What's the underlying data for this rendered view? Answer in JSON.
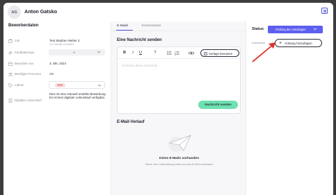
{
  "candidate": {
    "initials": "AG",
    "name": "Anton Gatsko"
  },
  "left": {
    "title": "Bewerberdaten",
    "job_label": "Job",
    "job_value": "Test Stephen Weber 3",
    "job_sub": "Von Kandelo Immobilia",
    "type_label": "Kandidatentyp",
    "type_value": "A",
    "applied_label": "Beworben am",
    "applied_value": "3. Okt. 2024",
    "involved_label": "Beteiligte Personen",
    "involved_value": "AG",
    "labels_label": "Labels",
    "labels_tag": "TEST",
    "cv_label": "Digitaler Lebenslauf",
    "cv_value": "Dies ist eine manuell erstellte Bewerbung. Es ist kein digitaler Lebenslauf verfügbar."
  },
  "mid": {
    "tab_emails": "E-Mails",
    "tab_comments": "Kommentare",
    "new_message_title": "Eine Nachricht senden",
    "template_button": "Vorlage benutzen",
    "placeholder": "Schreibe deine Nachricht",
    "send_button": "Nachricht senden",
    "history_title": "E-Mail-Verlauf",
    "empty_title": "Keine E-Mails vorhanden",
    "empty_sub": "Starte eine Unterhaltung indem du eine E-Mail versendest"
  },
  "right": {
    "status_label": "Status",
    "status_value": "Prüfung der Unterlagen",
    "docs_label": "Dokumente",
    "attach_button": "Anhang hinzufügen"
  },
  "colors": {
    "primary": "#5d5ff0",
    "send": "#6fe0b2",
    "arrow": "#e0332b"
  }
}
